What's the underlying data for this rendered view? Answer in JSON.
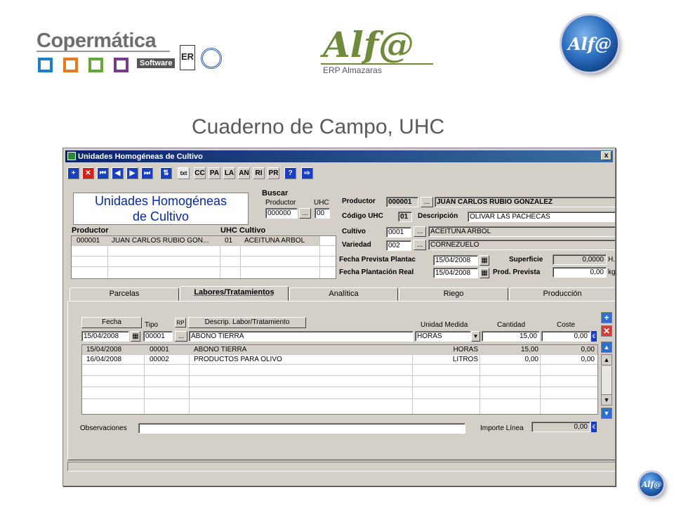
{
  "header": {
    "brand": "Copermática",
    "brand_sub": "Software",
    "cert1": "ER",
    "erp_logo": "Alf@",
    "erp_sub": "ERP Almazaras",
    "globe_logo": "Alf@",
    "corner_logo": "Alf@"
  },
  "page_title": "Cuaderno de Campo, UHC",
  "window": {
    "title": "Unidades Homogéneas de Cultivo",
    "close": "x"
  },
  "toolbar": {
    "items": [
      {
        "name": "add-icon",
        "label": "+"
      },
      {
        "name": "delete-icon",
        "label": "✕"
      },
      {
        "name": "first-icon",
        "label": "⏮"
      },
      {
        "name": "prev-icon",
        "label": "◀"
      },
      {
        "name": "next-icon",
        "label": "▶"
      },
      {
        "name": "last-icon",
        "label": "⏭"
      },
      {
        "name": "refresh-icon",
        "label": "⇅"
      },
      {
        "name": "txt-icon",
        "label": "txt"
      },
      {
        "name": "cc-icon",
        "label": "CC"
      },
      {
        "name": "pa-icon",
        "label": "PA"
      },
      {
        "name": "la-icon",
        "label": "LA"
      },
      {
        "name": "an-icon",
        "label": "AN"
      },
      {
        "name": "ri-icon",
        "label": "RI"
      },
      {
        "name": "pr-icon",
        "label": "PR"
      },
      {
        "name": "help-icon",
        "label": "?"
      },
      {
        "name": "exit-icon",
        "label": "⇨"
      }
    ]
  },
  "left_panel": {
    "heading_line1": "Unidades Homogéneas",
    "heading_line2": "de Cultivo",
    "buscar": "Buscar",
    "productor_label": "Productor",
    "productor_value": "000000",
    "uhc_label": "UHC",
    "uhc_value": "00",
    "browse": "...",
    "col_productor": "Productor",
    "col_uhc_cultivo": "UHC Cultivo",
    "rows": [
      {
        "code": "000001",
        "name": "JUAN CARLOS RUBIO GON...",
        "uhc": "01",
        "cultivo": "ACEITUNA ARBOL"
      }
    ]
  },
  "right_panel": {
    "productor_label": "Productor",
    "productor_code": "000001",
    "productor_name": "JUAN CARLOS RUBIO GONZALEZ",
    "codigo_uhc_label": "Código UHC",
    "codigo_uhc_value": "01",
    "descripcion_label": "Descripción",
    "descripcion_value": "OLIVAR LAS PACHECAS",
    "cultivo_label": "Cultivo",
    "cultivo_code": "0001",
    "cultivo_name": "ACEITUNA ARBOL",
    "variedad_label": "Variedad",
    "variedad_code": "002",
    "variedad_name": "CORNEZUELO",
    "fecha_prevista_label": "Fecha Prevista Plantac",
    "fecha_prevista_value": "15/04/2008",
    "fecha_real_label": "Fecha Plantación Real",
    "fecha_real_value": "15/04/2008",
    "superficie_label": "Superficie",
    "superficie_value": "0,0000",
    "superficie_unit": "H.",
    "prod_prevista_label": "Prod. Prevista",
    "prod_prevista_value": "0,00",
    "prod_prevista_unit": "kg"
  },
  "tabs": [
    "Parcelas",
    "Labores/Tratamientos",
    "Analítica",
    "Riego",
    "Producción"
  ],
  "labores": {
    "btn_fecha": "Fecha",
    "lbl_tipo": "Tipo",
    "btn_rp": "RP",
    "btn_descrip": "Descrip. Labor/Tratamiento",
    "lbl_unidad": "Unidad Medida",
    "lbl_cantidad": "Cantidad",
    "lbl_coste": "Coste",
    "edit_fecha": "15/04/2008",
    "edit_tipo": "00001",
    "edit_descrip": "ABONO TIERRA",
    "edit_unidad": "HORAS",
    "edit_cantidad": "15,00",
    "edit_coste": "0,00",
    "rows": [
      {
        "fecha": "15/04/2008",
        "tipo": "00001",
        "descrip": "ABONO TIERRA",
        "unidad": "HORAS",
        "cantidad": "15,00",
        "coste": "0,00"
      },
      {
        "fecha": "16/04/2008",
        "tipo": "00002",
        "descrip": "PRODUCTOS PARA OLIVO",
        "unidad": "LITROS",
        "cantidad": "0,00",
        "coste": "0,00"
      }
    ],
    "observaciones_label": "Observaciones",
    "observaciones_value": "",
    "importe_label": "Importe Línea",
    "importe_value": "0,00",
    "euro": "€"
  },
  "colors": {
    "titlebar": "#0a246a",
    "window": "#d4d0c8",
    "sel_row": "#d4d0c8"
  }
}
